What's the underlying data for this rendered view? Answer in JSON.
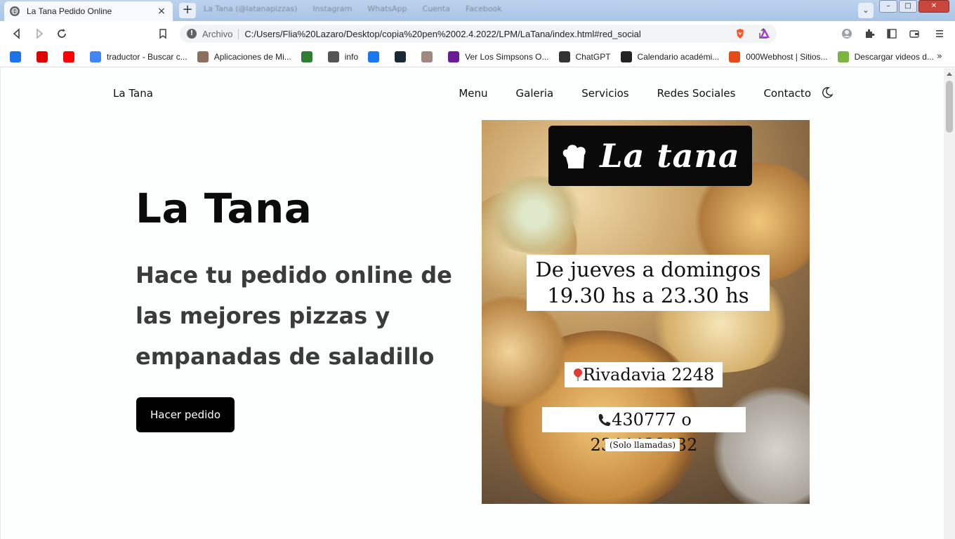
{
  "browser": {
    "tab_title": "La Tana Pedido Online",
    "tab_close": "×",
    "new_tab": "+",
    "background_tabs": [
      "La Tana (@latanapizzas)",
      "Instagram",
      "WhatsApp",
      "Cuenta",
      "Facebook"
    ],
    "omnibox": {
      "chip": "Archivo",
      "url": "C:/Users/Flia%20Lazaro/Desktop/copia%20pen%2002.4.2022/LPM/LaTana/index.html#red_social"
    },
    "window_controls": {
      "minimize": "–",
      "maximize": "□",
      "close": "✕"
    },
    "tab_search": "⌄"
  },
  "bookmarks": [
    {
      "label": "",
      "icon": "grid-icon",
      "color": "#1a73e8"
    },
    {
      "label": "",
      "icon": "record-icon",
      "color": "#e00000"
    },
    {
      "label": "",
      "icon": "youtube-icon",
      "color": "#ff0000"
    },
    {
      "label": "traductor - Buscar c...",
      "icon": "google-icon",
      "color": "#4285f4"
    },
    {
      "label": "Aplicaciones de Mi...",
      "icon": "apps-icon",
      "color": "#8d6e63"
    },
    {
      "label": "",
      "icon": "soccer-icon",
      "color": "#2e7d32"
    },
    {
      "label": "info",
      "icon": "gear-icon",
      "color": "#555555"
    },
    {
      "label": "",
      "icon": "facebook-icon",
      "color": "#1877f2"
    },
    {
      "label": "",
      "icon": "steam-icon",
      "color": "#1b2838"
    },
    {
      "label": "",
      "icon": "profile-icon",
      "color": "#a1887f"
    },
    {
      "label": "Ver Los Simpsons O...",
      "icon": "play-icon",
      "color": "#6a1b9a"
    },
    {
      "label": "ChatGPT",
      "icon": "openai-icon",
      "color": "#333333"
    },
    {
      "label": "Calendario académi...",
      "icon": "calendar-icon",
      "color": "#222222"
    },
    {
      "label": "000Webhost | Sitios...",
      "icon": "webhost-icon",
      "color": "#e64a19"
    },
    {
      "label": "Descargar videos d...",
      "icon": "download-icon",
      "color": "#7cb342"
    }
  ],
  "bookmarks_more": "»",
  "site": {
    "logo": "La Tana",
    "menu": [
      "Menu",
      "Galeria",
      "Servicios",
      "Redes Sociales",
      "Contacto"
    ],
    "hero": {
      "title": "La Tana",
      "subtitle": "Hace tu pedido online de las mejores pizzas y empanadas de saladillo",
      "cta": "Hacer pedido"
    },
    "poster": {
      "brand": "La tana",
      "hours_line1": "De jueves a domingos",
      "hours_line2": "19.30 hs a 23.30 hs",
      "address": "Rivadavia 2248",
      "phone": "430777 o 2344439132",
      "note": "(Solo llamadas)"
    }
  }
}
